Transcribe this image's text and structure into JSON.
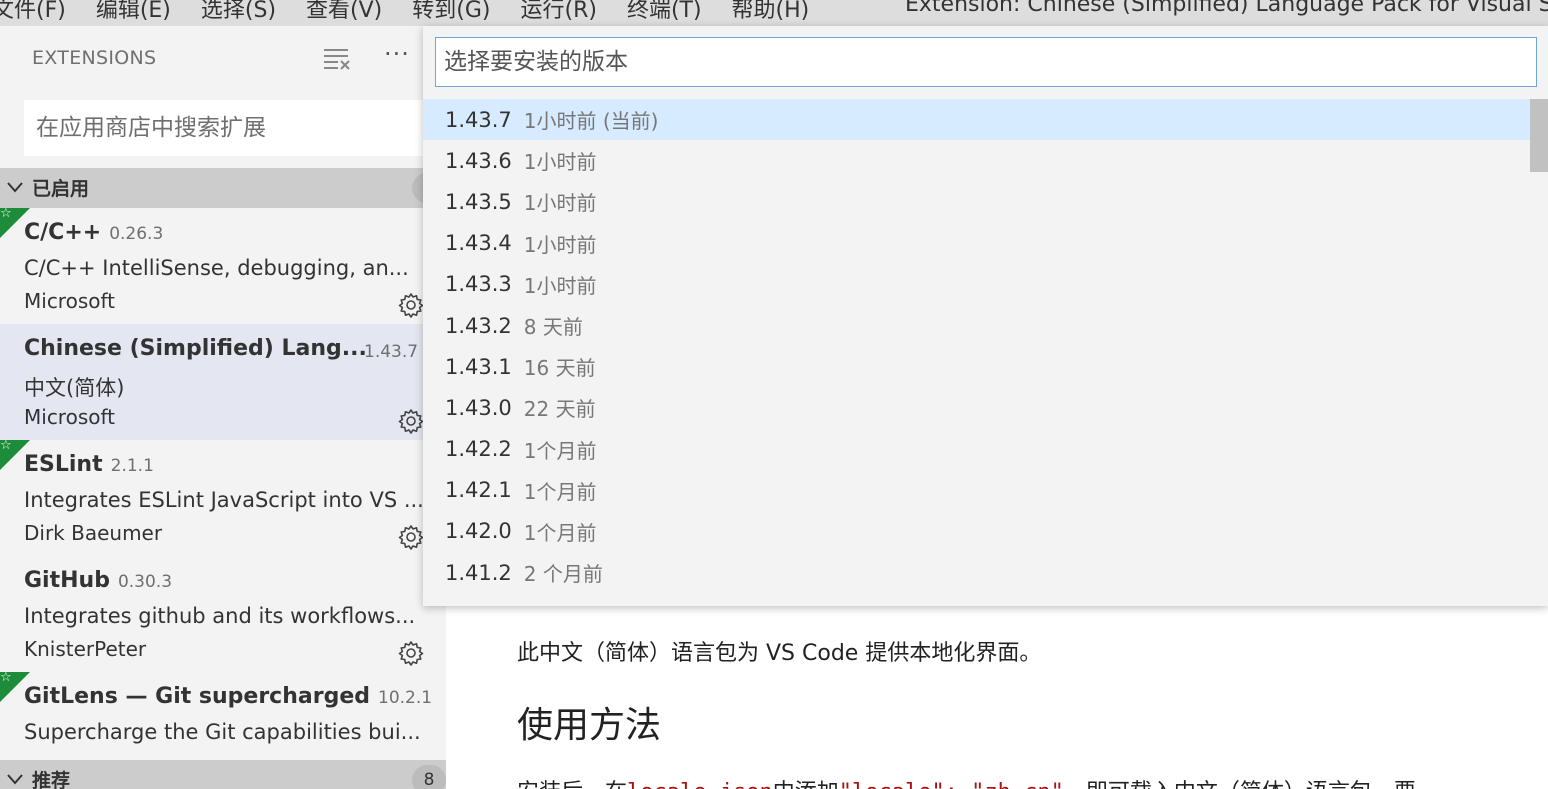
{
  "menubar": {
    "items": [
      "文件(F)",
      "编辑(E)",
      "选择(S)",
      "查看(V)",
      "转到(G)",
      "运行(R)",
      "终端(T)",
      "帮助(H)"
    ],
    "window_title": "Extension: Chinese (Simplified) Language Pack for Visual Studio C"
  },
  "sidebar": {
    "header": "EXTENSIONS",
    "more": "···",
    "search_placeholder": "在应用商店中搜索扩展",
    "enabled_section": {
      "title": "已启用"
    },
    "recommended_section": {
      "title": "推荐",
      "count": "8"
    },
    "extensions": [
      {
        "name": "C/C++",
        "version": "0.26.3",
        "description": "C/C++ IntelliSense, debugging, an...",
        "publisher": "Microsoft"
      },
      {
        "name": "Chinese (Simplified) Lang...",
        "version": "1.43.7",
        "description": "中文(简体)",
        "publisher": "Microsoft"
      },
      {
        "name": "ESLint",
        "version": "2.1.1",
        "description": "Integrates ESLint JavaScript into VS ...",
        "publisher": "Dirk Baeumer"
      },
      {
        "name": "GitHub",
        "version": "0.30.3",
        "description": "Integrates github and its workflows...",
        "publisher": "KnisterPeter"
      },
      {
        "name": "GitLens — Git supercharged",
        "version": "10.2.1",
        "description": "Supercharge the Git capabilities bui...",
        "publisher": ""
      }
    ],
    "star_glyph": "☆"
  },
  "quickpick": {
    "placeholder": "选择要安装的版本",
    "versions": [
      {
        "version": "1.43.7",
        "when": "1小时前 (当前)"
      },
      {
        "version": "1.43.6",
        "when": "1小时前"
      },
      {
        "version": "1.43.5",
        "when": "1小时前"
      },
      {
        "version": "1.43.4",
        "when": "1小时前"
      },
      {
        "version": "1.43.3",
        "when": "1小时前"
      },
      {
        "version": "1.43.2",
        "when": "8 天前"
      },
      {
        "version": "1.43.1",
        "when": "16 天前"
      },
      {
        "version": "1.43.0",
        "when": "22 天前"
      },
      {
        "version": "1.42.2",
        "when": "1个月前"
      },
      {
        "version": "1.42.1",
        "when": "1个月前"
      },
      {
        "version": "1.42.0",
        "when": "1个月前"
      },
      {
        "version": "1.41.2",
        "when": "2 个月前"
      }
    ]
  },
  "main": {
    "intro": "此中文（简体）语言包为 VS Code 提供本地化界面。",
    "usage_heading": "使用方法",
    "usage_prefix": "安装后，在",
    "usage_code1": "locale.json",
    "usage_mid": "中添加",
    "usage_code2": "\"locale\": \"zh-cn\"",
    "usage_suffix": "，即可载入中文（简体）语言包。要"
  },
  "colors": {
    "accent": "#6ea6d8",
    "active_row": "#d6ebff",
    "selected_item": "#e4e6f1",
    "badge_green": "#1c8c3a"
  }
}
